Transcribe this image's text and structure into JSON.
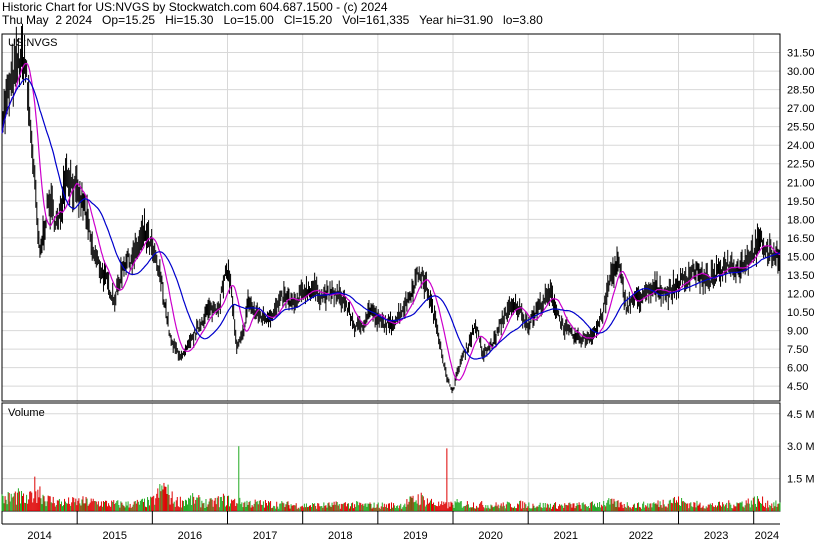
{
  "header": {
    "line1": "Historic Chart for US:NVGS by Stockwatch.com 604.687.1500 - (c) 2024",
    "line2": "Thu May  2 2024   Op=15.25   Hi=15.30   Lo=15.00   Cl=15.20   Vol=161,335   Year hi=31.90   lo=3.80"
  },
  "colors": {
    "price": "#000000",
    "ma_short": "#cc00cc",
    "ma_long": "#0000cc",
    "vol_up": "#22aa22",
    "vol_down": "#dd0000",
    "grid": "#d8d8d8",
    "frame": "#000000"
  },
  "chart_data": [
    {
      "type": "line",
      "title": "US:NVGS",
      "y_ticks": [
        "31.50",
        "30.00",
        "28.50",
        "27.00",
        "25.50",
        "24.00",
        "22.50",
        "21.00",
        "19.50",
        "18.00",
        "16.50",
        "15.00",
        "13.50",
        "12.00",
        "10.50",
        "9.00",
        "7.50",
        "6.00",
        "4.50"
      ],
      "ylim": [
        3.3,
        33.0
      ],
      "x_tick_labels": [
        "2014",
        "2015",
        "2016",
        "2017",
        "2018",
        "2019",
        "2020",
        "2021",
        "2022",
        "2023",
        "2024"
      ],
      "xlim": [
        2014.0,
        2024.35
      ],
      "series": [
        {
          "x": [
            2014.0,
            2014.1,
            2014.2,
            2014.3,
            2014.4,
            2014.5,
            2014.62,
            2014.75,
            2014.85,
            2015.0,
            2015.1,
            2015.2,
            2015.35,
            2015.5,
            2015.62,
            2015.75,
            2015.9,
            2016.0,
            2016.12,
            2016.25,
            2016.4,
            2016.55,
            2016.72,
            2016.88,
            2017.0,
            2017.05,
            2017.12,
            2017.2,
            2017.28,
            2017.35,
            2017.5,
            2017.62,
            2017.75,
            2017.9,
            2018.0,
            2018.15,
            2018.25,
            2018.4,
            2018.55,
            2018.7,
            2018.8,
            2018.9,
            2019.0,
            2019.15,
            2019.25,
            2019.4,
            2019.55,
            2019.65,
            2019.8,
            2019.92,
            2020.0,
            2020.1,
            2020.2,
            2020.3,
            2020.4,
            2020.55,
            2020.7,
            2020.85,
            2021.0,
            2021.15,
            2021.3,
            2021.45,
            2021.6,
            2021.75,
            2021.9,
            2022.0,
            2022.1,
            2022.2,
            2022.3,
            2022.4,
            2022.55,
            2022.7,
            2022.85,
            2023.0,
            2023.1,
            2023.2,
            2023.35,
            2023.5,
            2023.65,
            2023.8,
            2023.9,
            2024.0,
            2024.1,
            2024.2,
            2024.33
          ],
          "values": [
            26.0,
            28.5,
            30.5,
            31.2,
            24.0,
            15.0,
            19.5,
            17.5,
            22.0,
            20.0,
            19.0,
            15.5,
            13.5,
            11.5,
            14.5,
            15.0,
            17.0,
            15.5,
            13.0,
            8.0,
            6.8,
            8.5,
            10.5,
            11.0,
            14.0,
            12.5,
            7.5,
            8.5,
            11.5,
            10.5,
            10.0,
            10.5,
            11.8,
            11.0,
            12.2,
            12.4,
            11.8,
            12.0,
            11.5,
            9.2,
            9.5,
            10.8,
            9.8,
            9.4,
            10.0,
            11.5,
            13.8,
            12.5,
            9.0,
            5.0,
            4.2,
            6.5,
            7.8,
            9.5,
            7.0,
            8.2,
            10.5,
            11.0,
            9.5,
            11.0,
            12.0,
            9.5,
            8.5,
            8.3,
            9.0,
            10.5,
            13.5,
            14.5,
            11.0,
            11.5,
            11.8,
            12.5,
            12.0,
            12.8,
            13.2,
            14.0,
            13.0,
            13.5,
            14.5,
            14.0,
            14.8,
            15.5,
            16.2,
            15.2,
            15.2
          ]
        }
      ]
    },
    {
      "type": "bar",
      "title": "Volume",
      "y_ticks": [
        "4.5 M",
        "3.0 M",
        "1.5 M"
      ],
      "ylim": [
        0,
        5.0
      ],
      "x_tick_labels": [
        "2014",
        "2015",
        "2016",
        "2017",
        "2018",
        "2019",
        "2020",
        "2021",
        "2022",
        "2023",
        "2024"
      ],
      "series": [
        {
          "x": [
            2014.05,
            2014.2,
            2014.35,
            2014.45,
            2014.6,
            2014.8,
            2015.1,
            2015.4,
            2015.7,
            2016.0,
            2016.15,
            2016.3,
            2016.55,
            2016.75,
            2016.95,
            2017.15,
            2017.4,
            2017.7,
            2018.0,
            2018.3,
            2018.6,
            2018.9,
            2019.1,
            2019.3,
            2019.55,
            2019.8,
            2019.92,
            2020.05,
            2020.3,
            2020.6,
            2020.9,
            2021.2,
            2021.5,
            2021.8,
            2022.05,
            2022.25,
            2022.5,
            2022.75,
            2022.9,
            2023.2,
            2023.5,
            2023.8,
            2024.05,
            2024.25
          ],
          "values": [
            0.65,
            0.8,
            0.5,
            1.3,
            0.6,
            0.45,
            0.5,
            0.4,
            0.35,
            0.5,
            1.2,
            0.5,
            0.6,
            0.4,
            0.6,
            0.45,
            0.4,
            0.35,
            0.3,
            0.3,
            0.35,
            0.3,
            0.3,
            0.3,
            0.7,
            0.35,
            0.3,
            0.4,
            0.35,
            0.3,
            0.35,
            0.3,
            0.3,
            0.3,
            0.45,
            0.35,
            0.3,
            0.4,
            0.6,
            0.35,
            0.3,
            0.4,
            0.55,
            0.35
          ],
          "spikes": [
            [
              2017.15,
              3.0
            ],
            [
              2019.92,
              2.9
            ],
            [
              2016.15,
              1.3
            ]
          ]
        }
      ]
    }
  ]
}
